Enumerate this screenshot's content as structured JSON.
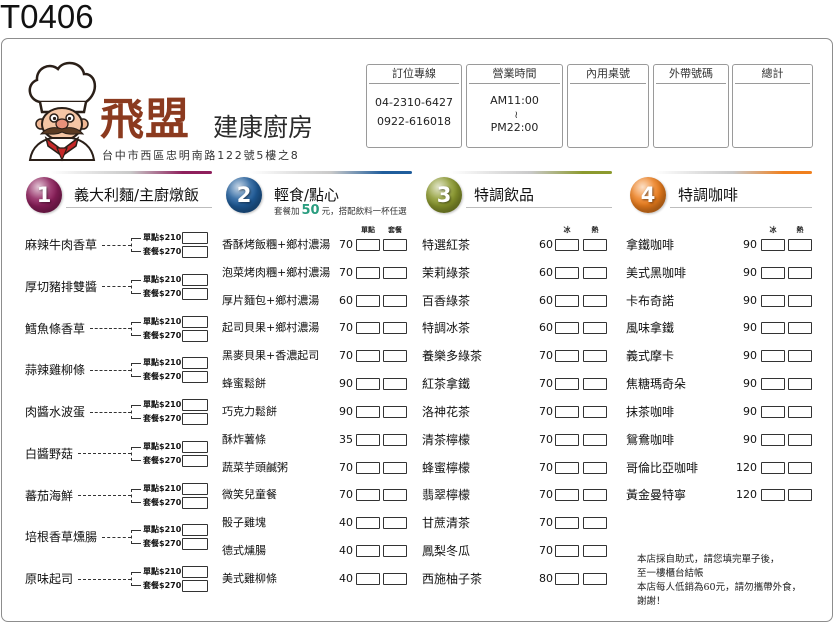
{
  "form_code": "T0406",
  "brand": {
    "logo_icon": "chef-logo-icon",
    "name": "飛盟",
    "tagline": "建康廚房",
    "address": "台中市西區忠明南路122號5樓之8",
    "color": "#8b3a1f"
  },
  "info_boxes": [
    {
      "label": "訂位專線",
      "lines": [
        "04-2310-6427",
        "0922-616018"
      ]
    },
    {
      "label": "營業時間",
      "lines": [
        "AM11:00",
        "~",
        "PM22:00"
      ]
    },
    {
      "label": "內用桌號",
      "lines": []
    },
    {
      "label": "外帶號碼",
      "lines": []
    },
    {
      "label": "總計",
      "lines": []
    }
  ],
  "sections": [
    {
      "number": "1",
      "title": "義大利麵/主廚燉飯",
      "color": "#8e1f5c",
      "items": [
        {
          "name": "麻辣牛肉香草",
          "options": [
            "單點$210",
            "套餐$270"
          ]
        },
        {
          "name": "厚切豬排雙醬",
          "options": [
            "單點$210",
            "套餐$270"
          ]
        },
        {
          "name": "鱈魚條香草",
          "options": [
            "單點$210",
            "套餐$270"
          ]
        },
        {
          "name": "蒜辣雞柳條",
          "options": [
            "單點$210",
            "套餐$270"
          ]
        },
        {
          "name": "肉醬水波蛋",
          "options": [
            "單點$210",
            "套餐$270"
          ]
        },
        {
          "name": "白醬野菇",
          "options": [
            "單點$210",
            "套餐$270"
          ]
        },
        {
          "name": "蕃茄海鮮",
          "options": [
            "單點$210",
            "套餐$270"
          ]
        },
        {
          "name": "培根香草燻腸",
          "options": [
            "單點$210",
            "套餐$270"
          ]
        },
        {
          "name": "原味起司",
          "options": [
            "單點$210",
            "套餐$270"
          ]
        }
      ]
    },
    {
      "number": "2",
      "title": "輕食/點心",
      "color": "#1f5d9c",
      "subtitle": {
        "prefix": "套餐加",
        "amount": "50",
        "suffix": "元，搭配飲料一杯任選",
        "amount_color": "#2a9d7f"
      },
      "check_headers": [
        "單點",
        "套餐"
      ],
      "items": [
        {
          "name": "香酥烤飯糰+鄉村濃湯",
          "price": "70"
        },
        {
          "name": "泡菜烤肉糰+鄉村濃湯",
          "price": "70"
        },
        {
          "name": "厚片麵包+鄉村濃湯",
          "price": "60"
        },
        {
          "name": "起司貝果+鄉村濃湯",
          "price": "70"
        },
        {
          "name": "黑麥貝果+香濃起司",
          "price": "70"
        },
        {
          "name": "蜂蜜鬆餅",
          "price": "90"
        },
        {
          "name": "巧克力鬆餅",
          "price": "90"
        },
        {
          "name": "酥炸薯條",
          "price": "35"
        },
        {
          "name": "蔬菜芋頭鹹粥",
          "price": "70"
        },
        {
          "name": "微笑兒童餐",
          "price": "70"
        },
        {
          "name": "骰子雞塊",
          "price": "40"
        },
        {
          "name": "德式燻腸",
          "price": "40"
        },
        {
          "name": "美式雞柳條",
          "price": "40"
        }
      ]
    },
    {
      "number": "3",
      "title": "特調飲品",
      "color": "#8c9a2e",
      "check_headers": [
        "冰",
        "熱"
      ],
      "items": [
        {
          "name": "特選紅茶",
          "price": "60"
        },
        {
          "name": "茉莉綠茶",
          "price": "60"
        },
        {
          "name": "百香綠茶",
          "price": "60"
        },
        {
          "name": "特調冰茶",
          "price": "60"
        },
        {
          "name": "養樂多綠茶",
          "price": "70"
        },
        {
          "name": "紅茶拿鐵",
          "price": "70"
        },
        {
          "name": "洛神花茶",
          "price": "70"
        },
        {
          "name": "清茶檸檬",
          "price": "70"
        },
        {
          "name": "蜂蜜檸檬",
          "price": "70"
        },
        {
          "name": "翡翠檸檬",
          "price": "70"
        },
        {
          "name": "甘蔗清茶",
          "price": "70"
        },
        {
          "name": "鳳梨冬瓜",
          "price": "70"
        },
        {
          "name": "西施柚子茶",
          "price": "80"
        }
      ]
    },
    {
      "number": "4",
      "title": "特調咖啡",
      "color": "#f0801e",
      "check_headers": [
        "冰",
        "熱"
      ],
      "items": [
        {
          "name": "拿鐵咖啡",
          "price": "90"
        },
        {
          "name": "美式黑咖啡",
          "price": "90"
        },
        {
          "name": "卡布奇諾",
          "price": "90"
        },
        {
          "name": "風味拿鐵",
          "price": "90"
        },
        {
          "name": "義式摩卡",
          "price": "90"
        },
        {
          "name": "焦糖瑪奇朵",
          "price": "90"
        },
        {
          "name": "抹茶咖啡",
          "price": "90"
        },
        {
          "name": "鴛鴦咖啡",
          "price": "90"
        },
        {
          "name": "哥倫比亞咖啡",
          "price": "120"
        },
        {
          "name": "黃金曼特寧",
          "price": "120"
        }
      ]
    }
  ],
  "notes": [
    "本店採自助式，請您填完單子後，",
    "至一樓櫃台結帳",
    "本店每人低銷為60元，請勿攜帶外食，",
    "謝謝！"
  ]
}
